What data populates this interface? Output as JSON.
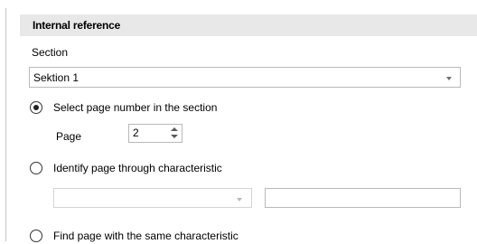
{
  "group": {
    "title": "Internal reference"
  },
  "section": {
    "label": "Section",
    "selected": "Sektion 1"
  },
  "options": {
    "select_page_number": {
      "label": "Select page number in the section",
      "checked": true,
      "page_label": "Page",
      "page_value": "2"
    },
    "identify_by_characteristic": {
      "label": "Identify page through characteristic",
      "checked": false,
      "characteristic_selected": "",
      "characteristic_value": ""
    },
    "find_same_characteristic": {
      "label": "Find page with the same characteristic",
      "checked": false
    }
  },
  "icons": {
    "dropdown": "chevron-down-icon",
    "spin_up": "spin-up-icon",
    "spin_down": "spin-down-icon"
  },
  "colors": {
    "header_bg": "#e8e8e8",
    "border": "#b9b9b9",
    "disabled_border": "#d3d3d3"
  }
}
